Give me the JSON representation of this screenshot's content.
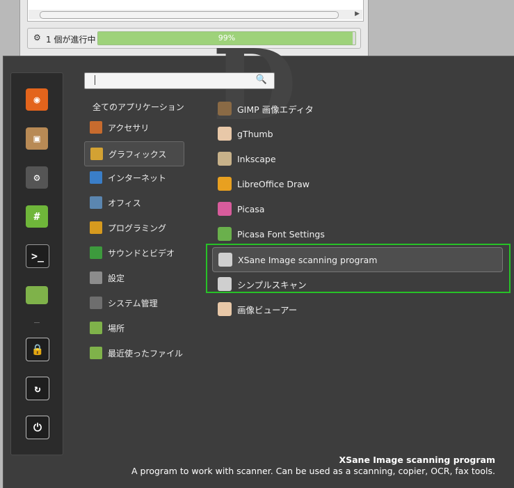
{
  "progress": {
    "status_label": "1 個が進行中",
    "percent_label": "99%",
    "percent": 99
  },
  "search": {
    "placeholder": ""
  },
  "categories": {
    "all": "全てのアプリケーション",
    "items": [
      {
        "label": "アクセサリ",
        "icon": "accessories-icon",
        "color": "#c76b2e"
      },
      {
        "label": "グラフィックス",
        "icon": "graphics-icon",
        "color": "#d3a233",
        "selected": true
      },
      {
        "label": "インターネット",
        "icon": "internet-icon",
        "color": "#3a7ec8"
      },
      {
        "label": "オフィス",
        "icon": "office-icon",
        "color": "#5b86b0"
      },
      {
        "label": "プログラミング",
        "icon": "programming-icon",
        "color": "#d69a1e"
      },
      {
        "label": "サウンドとビデオ",
        "icon": "sound-video-icon",
        "color": "#3d9a3d"
      },
      {
        "label": "設定",
        "icon": "settings-icon",
        "color": "#8c8c8c"
      },
      {
        "label": "システム管理",
        "icon": "system-admin-icon",
        "color": "#6e6e6e"
      },
      {
        "label": "場所",
        "icon": "places-folder-icon",
        "color": "#7fb24a"
      },
      {
        "label": "最近使ったファイル",
        "icon": "recent-files-icon",
        "color": "#7fb24a"
      }
    ]
  },
  "apps": [
    {
      "label": "GIMP 画像エディタ",
      "icon": "gimp-icon",
      "color": "#8a6a45"
    },
    {
      "label": "gThumb",
      "icon": "gthumb-icon",
      "color": "#e8c8a8"
    },
    {
      "label": "Inkscape",
      "icon": "inkscape-icon",
      "color": "#c8b28a"
    },
    {
      "label": "LibreOffice Draw",
      "icon": "libreoffice-draw-icon",
      "color": "#e8a020"
    },
    {
      "label": "Picasa",
      "icon": "picasa-icon",
      "color": "#d85c9c"
    },
    {
      "label": "Picasa Font Settings",
      "icon": "picasa-font-settings-icon",
      "color": "#6ab04c"
    },
    {
      "label": "XSane Image scanning program",
      "icon": "xsane-icon",
      "color": "#cfcfcf",
      "hover": true
    },
    {
      "label": "シンプルスキャン",
      "icon": "simple-scan-icon",
      "color": "#cfcfcf"
    },
    {
      "label": "画像ビューアー",
      "icon": "image-viewer-icon",
      "color": "#e8c8a8"
    }
  ],
  "favorites": [
    {
      "name": "firefox-icon",
      "color": "#e3641c"
    },
    {
      "name": "software-manager-icon",
      "color": "#b88a55"
    },
    {
      "name": "system-settings-icon",
      "color": "#555555"
    },
    {
      "name": "hexchat-icon",
      "color": "#6fb63a",
      "glyph": "#"
    },
    {
      "name": "terminal-icon",
      "color": "#1e1e1e",
      "glyph": ">_"
    },
    {
      "name": "files-folder-icon",
      "color": "#7fb24a"
    },
    {
      "name": "lock-screen-icon",
      "color": "#1e1e1e"
    },
    {
      "name": "logout-icon",
      "color": "#1e1e1e"
    },
    {
      "name": "shutdown-icon",
      "color": "#1e1e1e"
    }
  ],
  "description": {
    "title": "XSane Image scanning program",
    "text": "A program to work with scanner. Can be used as a scanning, copier, OCR, fax tools."
  },
  "accent_highlight": "#27c227"
}
